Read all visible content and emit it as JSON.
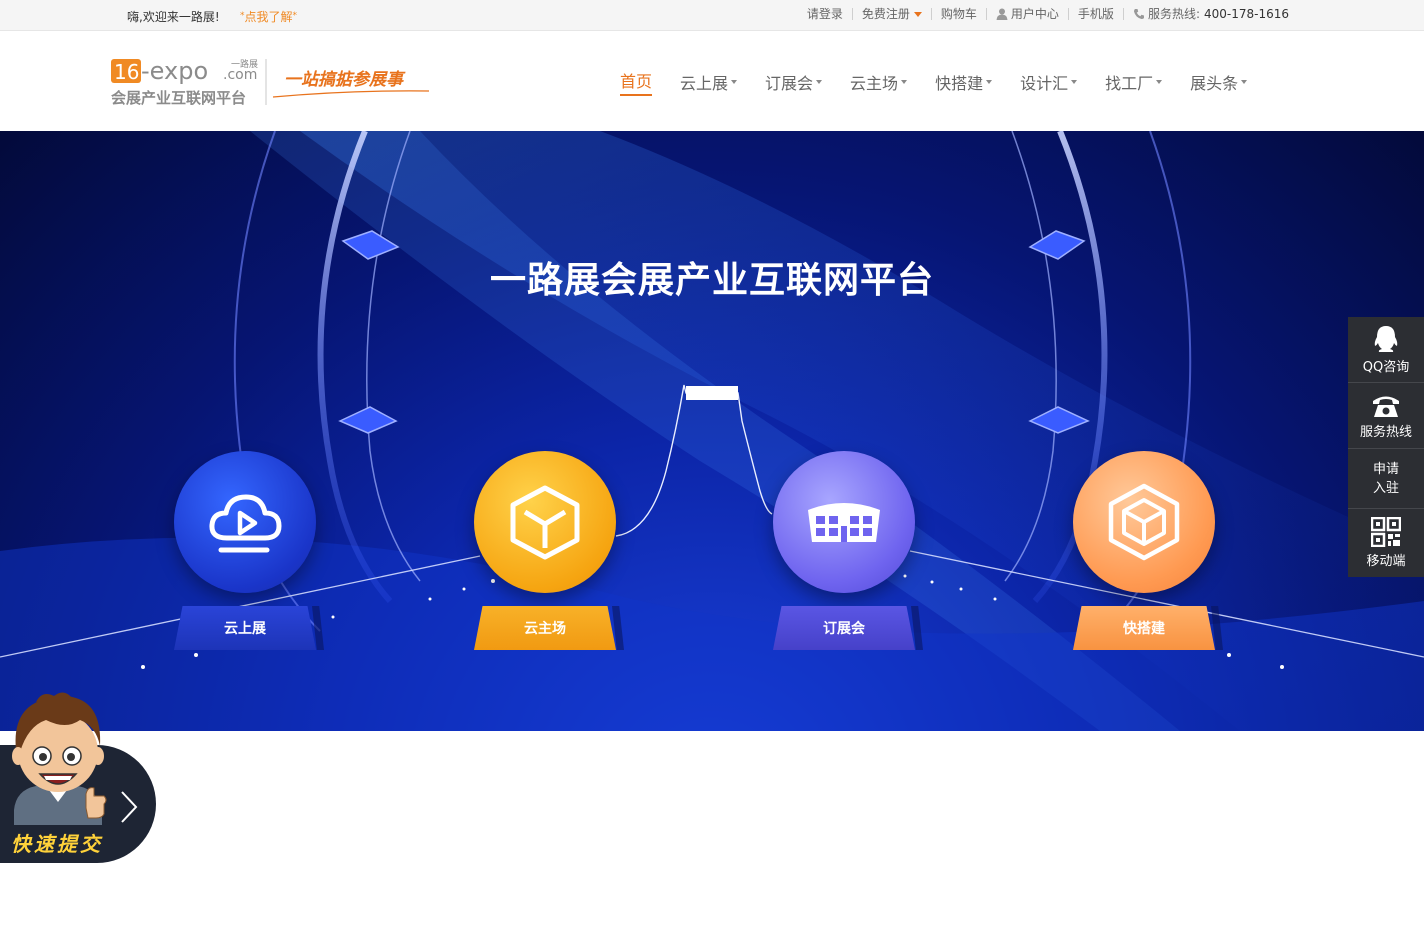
{
  "topbar": {
    "welcome": "嗨,欢迎来一路展!",
    "learn": "点我了解",
    "links": {
      "login": "请登录",
      "register": "免费注册",
      "cart": "购物车",
      "user_center": "用户中心",
      "mobile": "手机版",
      "hotline_label": "服务热线:",
      "hotline_number": "400-178-1616"
    }
  },
  "logo": {
    "brand_num": "16",
    "brand_domain": "-expo",
    "brand_com": ".com",
    "brand_cn_small": "一路展",
    "subtitle": "会展产业互联网平台",
    "slogan": "一站搞掂参展事"
  },
  "nav": {
    "items": [
      {
        "label": "首页",
        "dropdown": false
      },
      {
        "label": "云上展",
        "dropdown": true
      },
      {
        "label": "订展会",
        "dropdown": true
      },
      {
        "label": "云主场",
        "dropdown": true
      },
      {
        "label": "快搭建",
        "dropdown": true
      },
      {
        "label": "设计汇",
        "dropdown": true
      },
      {
        "label": "找工厂",
        "dropdown": true
      },
      {
        "label": "展头条",
        "dropdown": true
      }
    ]
  },
  "banner": {
    "title": "一路展会展产业互联网平台",
    "features": [
      {
        "label": "云上展",
        "icon": "cloud-play-icon"
      },
      {
        "label": "云主场",
        "icon": "cube-icon"
      },
      {
        "label": "订展会",
        "icon": "stadium-icon"
      },
      {
        "label": "快搭建",
        "icon": "hexagon-cube-icon"
      }
    ]
  },
  "side": {
    "qq": "QQ咨询",
    "hotline": "服务热线",
    "apply_line1": "申请",
    "apply_line2": "入驻",
    "mobile": "移动端"
  },
  "quick": {
    "label": "快速提交"
  },
  "colors": {
    "accent": "#e8731d",
    "banner_dark": "#030a3a",
    "banner_blue": "#1b44e0",
    "sidebar": "#2c2e33"
  }
}
